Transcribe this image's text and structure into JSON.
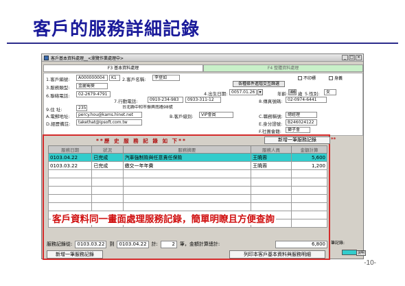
{
  "slide": {
    "title": "客戶的服務詳細記錄",
    "page_number": "-10-"
  },
  "window": {
    "title": "客戶基本資料處理__<瀏覽作業處理中>",
    "tabs": [
      {
        "label": "F3 基本資料處理",
        "active": true
      },
      {
        "label": "F4 整體資料處理",
        "active": false
      }
    ]
  },
  "form": {
    "customer_no_label": "1.客戶編號:",
    "customer_no": "A000000004",
    "customer_no_suffix": "K1",
    "customer_name_label": "2.客戶名稱:",
    "customer_name": "李登如",
    "top_checks": [
      {
        "label": "不印標"
      },
      {
        "label": "身義"
      }
    ],
    "cond_button": "各種條件進階交互篩選",
    "service_type_label": "3.服務類型:",
    "service_type": "金麗蜀葵",
    "birthday_label": "4.出生日期:",
    "birthday": "0057.01.26",
    "age_label": "年齡:",
    "age": "46",
    "age_unit": "歲",
    "gender_label": "5.性別:",
    "gender": "女",
    "contact_phone_label": "6.聯絡電話:",
    "contact_phone": "02-2679-4791",
    "mobile_label": "7.行動電話:",
    "mobile": "0910-234-983",
    "mobile2": "0933-311-12",
    "fax_label": "8.傳真號碼:",
    "fax": "02-0974-6441",
    "address_label": "9.住    址:",
    "postal_code": "235",
    "address": "台北縣中和市振興南路98號",
    "email_label": "A.電郵地址:",
    "email": "percy.hou@kams.hinet.net",
    "customer_level_label": "B.客戶級別:",
    "customer_level": "VIP會員",
    "job_label": "C.職務稱號:",
    "job": "總經理",
    "remark_label": "D.經歷備註:",
    "remark": "takethat@ipsoft.com.tw",
    "id_label": "E.身分證號:",
    "id_no": "B246024122",
    "group_label": "F.社團會籍:",
    "group": "獅子會"
  },
  "service": {
    "title": "**歷 史 服 務 記 錄 如 下**",
    "add_button_top": "新增一筆服務記錄",
    "stray_mark": "**",
    "columns": [
      "服務日期",
      "狀況",
      "服務摘要",
      "服務人員",
      "金額計算"
    ],
    "rows": [
      [
        "0103.04.22",
        "已完成",
        "汽車強制險與任意責任保險",
        "王曉蓉",
        "5,600"
      ],
      [
        "0103.03.22",
        "已完成",
        "繳交一年年費",
        "王曉蓉",
        "1,200"
      ],
      [
        "",
        "",
        "",
        "",
        ""
      ],
      [
        "",
        "",
        "",
        "",
        ""
      ],
      [
        "",
        "",
        "",
        "",
        ""
      ],
      [
        "",
        "",
        "",
        "",
        ""
      ],
      [
        "",
        "",
        "",
        "",
        ""
      ],
      [
        "",
        "",
        "",
        "",
        ""
      ],
      [
        "",
        "",
        "",
        "",
        ""
      ]
    ],
    "overlay_caption": "客戶資料同一畫面處理服務記錄，簡單明瞭且方便查詢",
    "summary": {
      "date_label": "服務記錄從:",
      "date_from": "0103.03.22",
      "to_label": "到",
      "date_to": "0103.04.22",
      "count_label": "計:",
      "count": "2",
      "count_unit": "筆，金額計算總計:",
      "total": "6,800"
    },
    "add_button_bottom": "新增一筆服務記錄",
    "print_button": "列印本客戶基本資料與服務明細"
  },
  "side": {
    "label": "筆記錄:",
    "btn": "說明"
  }
}
